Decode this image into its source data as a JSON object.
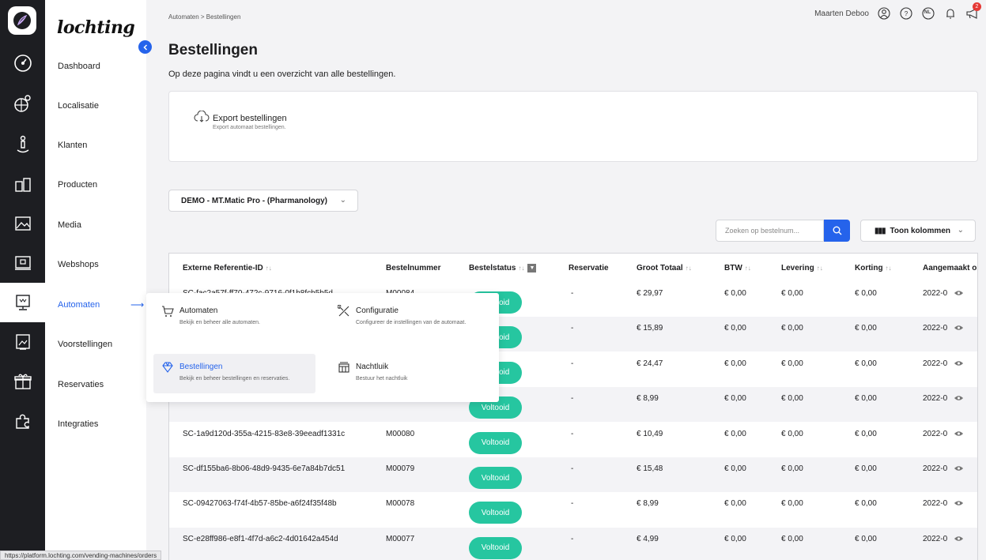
{
  "brand": "lochting",
  "sidebar": {
    "items": [
      {
        "label": "Dashboard",
        "icon": "dashboard-icon"
      },
      {
        "label": "Localisatie",
        "icon": "globe-icon"
      },
      {
        "label": "Klanten",
        "icon": "customer-icon"
      },
      {
        "label": "Producten",
        "icon": "products-icon"
      },
      {
        "label": "Media",
        "icon": "image-icon"
      },
      {
        "label": "Webshops",
        "icon": "webshop-icon"
      },
      {
        "label": "Automaten",
        "icon": "vending-machine-icon"
      },
      {
        "label": "Voorstellingen",
        "icon": "presentation-icon"
      },
      {
        "label": "Reservaties",
        "icon": "gift-icon"
      },
      {
        "label": "Integraties",
        "icon": "puzzle-icon"
      }
    ]
  },
  "header": {
    "breadcrumb": "Automaten > Bestellingen",
    "user_name": "Maarten Deboo",
    "language": "NL",
    "notification_count": "2"
  },
  "page": {
    "title": "Bestellingen",
    "subtitle": "Op deze pagina vindt u een overzicht van alle bestellingen."
  },
  "export": {
    "title": "Export bestellingen",
    "subtitle": "Export automaat bestellingen."
  },
  "machine_select": {
    "value": "DEMO - MT.Matic Pro - (Pharmanology)"
  },
  "search": {
    "placeholder": "Zoeken op bestelnum..."
  },
  "columns_button": {
    "label": "Toon kolommen"
  },
  "table": {
    "headers": [
      "Externe Referentie-ID",
      "Bestelnummer",
      "Bestelstatus",
      "Reservatie",
      "Groot Totaal",
      "BTW",
      "Levering",
      "Korting",
      "Aangemaakt o"
    ],
    "rows": [
      {
        "ref": "SC-fac2a57f-ff70-472c-9716-0f1b8fcb5b5d",
        "nr": "M00084",
        "status": "Voltooid",
        "res": "-",
        "total": "€ 29,97",
        "btw": "€ 0,00",
        "lev": "€ 0,00",
        "kor": "€ 0,00",
        "date": "2022-0"
      },
      {
        "ref": "",
        "nr": "",
        "status": "Voltooid",
        "res": "-",
        "total": "€ 15,89",
        "btw": "€ 0,00",
        "lev": "€ 0,00",
        "kor": "€ 0,00",
        "date": "2022-0"
      },
      {
        "ref": "",
        "nr": "",
        "status": "Voltooid",
        "res": "-",
        "total": "€ 24,47",
        "btw": "€ 0,00",
        "lev": "€ 0,00",
        "kor": "€ 0,00",
        "date": "2022-0"
      },
      {
        "ref": "",
        "nr": "",
        "status": "Voltooid",
        "res": "-",
        "total": "€ 8,99",
        "btw": "€ 0,00",
        "lev": "€ 0,00",
        "kor": "€ 0,00",
        "date": "2022-0"
      },
      {
        "ref": "SC-1a9d120d-355a-4215-83e8-39eeadf1331c",
        "nr": "M00080",
        "status": "Voltooid",
        "res": "-",
        "total": "€ 10,49",
        "btw": "€ 0,00",
        "lev": "€ 0,00",
        "kor": "€ 0,00",
        "date": "2022-0"
      },
      {
        "ref": "SC-df155ba6-8b06-48d9-9435-6e7a84b7dc51",
        "nr": "M00079",
        "status": "Voltooid",
        "res": "-",
        "total": "€ 15,48",
        "btw": "€ 0,00",
        "lev": "€ 0,00",
        "kor": "€ 0,00",
        "date": "2022-0"
      },
      {
        "ref": "SC-09427063-f74f-4b57-85be-a6f24f35f48b",
        "nr": "M00078",
        "status": "Voltooid",
        "res": "-",
        "total": "€ 8,99",
        "btw": "€ 0,00",
        "lev": "€ 0,00",
        "kor": "€ 0,00",
        "date": "2022-0"
      },
      {
        "ref": "SC-e28ff986-e8f1-4f7d-a6c2-4d01642a454d",
        "nr": "M00077",
        "status": "Voltooid",
        "res": "-",
        "total": "€ 4,99",
        "btw": "€ 0,00",
        "lev": "€ 0,00",
        "kor": "€ 0,00",
        "date": "2022-0"
      }
    ]
  },
  "submenu": {
    "items": [
      {
        "title": "Automaten",
        "desc": "Bekijk en beheer alle automaten."
      },
      {
        "title": "Configuratie",
        "desc": "Configureer de instellingen van de automaat."
      },
      {
        "title": "Bestellingen",
        "desc": "Bekijk en beheer bestellingen en reservaties."
      },
      {
        "title": "Nachtluik",
        "desc": "Bestuur het nachtluik"
      }
    ]
  },
  "status_url": "https://platform.lochting.com/vending-machines/orders",
  "colors": {
    "accent": "#2563eb",
    "status_done": "#26c6a0",
    "rail": "#1d1e22"
  }
}
